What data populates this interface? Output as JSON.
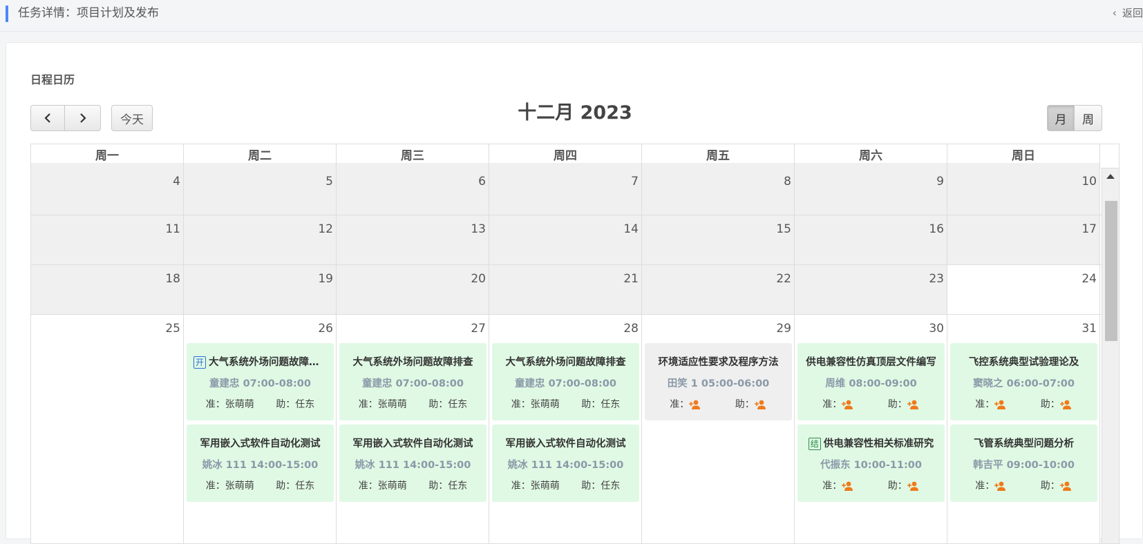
{
  "header": {
    "title": "任务详情：项目计划及发布",
    "back_label": "返回"
  },
  "panel": {
    "title": "日程日历"
  },
  "toolbar": {
    "today_label": "今天",
    "month_label": "月",
    "week_label": "周",
    "calendar_title": "十二月 2023"
  },
  "weekdays": [
    "周一",
    "周二",
    "周三",
    "周四",
    "周五",
    "周六",
    "周日"
  ],
  "rows": [
    {
      "days": [
        "4",
        "5",
        "6",
        "7",
        "8",
        "9",
        "10"
      ]
    },
    {
      "days": [
        "11",
        "12",
        "13",
        "14",
        "15",
        "16",
        "17"
      ]
    },
    {
      "days": [
        "18",
        "19",
        "20",
        "21",
        "22",
        "23",
        "24"
      ]
    },
    {
      "days": [
        "25",
        "26",
        "27",
        "28",
        "29",
        "30",
        "31"
      ]
    }
  ],
  "events": [
    {
      "title": "大气系统外场问题故障排查",
      "tag": "开",
      "sub": "童建忠 07:00-08:00",
      "zhun": "准：张萌萌",
      "zhu": "助：任东"
    },
    {
      "title": "大气系统外场问题故障排查",
      "tag": "",
      "sub": "童建忠 07:00-08:00",
      "zhun": "准：张萌萌",
      "zhu": "助：任东"
    },
    {
      "title": "大气系统外场问题故障排查",
      "tag": "",
      "sub": "童建忠 07:00-08:00",
      "zhun": "准：张萌萌",
      "zhu": "助：任东"
    },
    {
      "title": "环境适应性要求及程序方法",
      "tag": "",
      "sub": "田笑 1 05:00-06:00",
      "zhun": "准：",
      "zhu": "助："
    },
    {
      "title": "供电兼容性仿真顶层文件编写",
      "tag": "",
      "sub": "周维 08:00-09:00",
      "zhun": "准：",
      "zhu": "助："
    },
    {
      "title": "飞控系统典型试验理论及",
      "tag": "",
      "sub": "窦晓之 06:00-07:00",
      "zhun": "准：",
      "zhu": "助："
    },
    {
      "title": "军用嵌入式软件自动化测试",
      "tag": "",
      "sub": "姚冰 111 14:00-15:00",
      "zhun": "准：张萌萌",
      "zhu": "助：任东"
    },
    {
      "title": "军用嵌入式软件自动化测试",
      "tag": "",
      "sub": "姚冰 111 14:00-15:00",
      "zhun": "准：张萌萌",
      "zhu": "助：任东"
    },
    {
      "title": "军用嵌入式软件自动化测试",
      "tag": "",
      "sub": "姚冰 111 14:00-15:00",
      "zhun": "准：张萌萌",
      "zhu": "助：任东"
    },
    {
      "title": "供电兼容性相关标准研究",
      "tag": "结",
      "sub": "代振东 10:00-11:00",
      "zhun": "准：",
      "zhu": "助："
    },
    {
      "title": "飞管系统典型问题分析",
      "tag": "",
      "sub": "韩吉平 09:00-10:00",
      "zhun": "准：",
      "zhu": "助："
    }
  ],
  "colors": {
    "accent": "#4e86f7",
    "event_green": "#e0f9e4",
    "event_gray": "#efefef",
    "icon_orange": "#f07a1a"
  }
}
